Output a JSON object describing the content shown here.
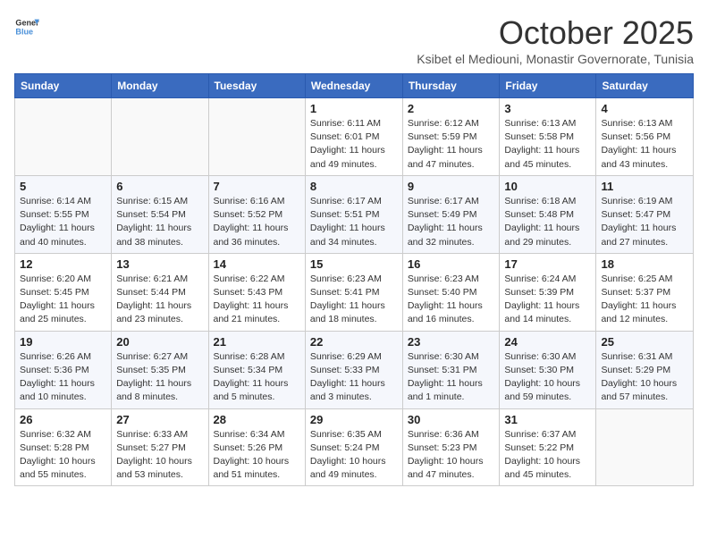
{
  "logo": {
    "line1": "General",
    "line2": "Blue"
  },
  "title": "October 2025",
  "subtitle": "Ksibet el Mediouni, Monastir Governorate, Tunisia",
  "weekdays": [
    "Sunday",
    "Monday",
    "Tuesday",
    "Wednesday",
    "Thursday",
    "Friday",
    "Saturday"
  ],
  "weeks": [
    [
      {
        "day": "",
        "info": ""
      },
      {
        "day": "",
        "info": ""
      },
      {
        "day": "",
        "info": ""
      },
      {
        "day": "1",
        "info": "Sunrise: 6:11 AM\nSunset: 6:01 PM\nDaylight: 11 hours\nand 49 minutes."
      },
      {
        "day": "2",
        "info": "Sunrise: 6:12 AM\nSunset: 5:59 PM\nDaylight: 11 hours\nand 47 minutes."
      },
      {
        "day": "3",
        "info": "Sunrise: 6:13 AM\nSunset: 5:58 PM\nDaylight: 11 hours\nand 45 minutes."
      },
      {
        "day": "4",
        "info": "Sunrise: 6:13 AM\nSunset: 5:56 PM\nDaylight: 11 hours\nand 43 minutes."
      }
    ],
    [
      {
        "day": "5",
        "info": "Sunrise: 6:14 AM\nSunset: 5:55 PM\nDaylight: 11 hours\nand 40 minutes."
      },
      {
        "day": "6",
        "info": "Sunrise: 6:15 AM\nSunset: 5:54 PM\nDaylight: 11 hours\nand 38 minutes."
      },
      {
        "day": "7",
        "info": "Sunrise: 6:16 AM\nSunset: 5:52 PM\nDaylight: 11 hours\nand 36 minutes."
      },
      {
        "day": "8",
        "info": "Sunrise: 6:17 AM\nSunset: 5:51 PM\nDaylight: 11 hours\nand 34 minutes."
      },
      {
        "day": "9",
        "info": "Sunrise: 6:17 AM\nSunset: 5:49 PM\nDaylight: 11 hours\nand 32 minutes."
      },
      {
        "day": "10",
        "info": "Sunrise: 6:18 AM\nSunset: 5:48 PM\nDaylight: 11 hours\nand 29 minutes."
      },
      {
        "day": "11",
        "info": "Sunrise: 6:19 AM\nSunset: 5:47 PM\nDaylight: 11 hours\nand 27 minutes."
      }
    ],
    [
      {
        "day": "12",
        "info": "Sunrise: 6:20 AM\nSunset: 5:45 PM\nDaylight: 11 hours\nand 25 minutes."
      },
      {
        "day": "13",
        "info": "Sunrise: 6:21 AM\nSunset: 5:44 PM\nDaylight: 11 hours\nand 23 minutes."
      },
      {
        "day": "14",
        "info": "Sunrise: 6:22 AM\nSunset: 5:43 PM\nDaylight: 11 hours\nand 21 minutes."
      },
      {
        "day": "15",
        "info": "Sunrise: 6:23 AM\nSunset: 5:41 PM\nDaylight: 11 hours\nand 18 minutes."
      },
      {
        "day": "16",
        "info": "Sunrise: 6:23 AM\nSunset: 5:40 PM\nDaylight: 11 hours\nand 16 minutes."
      },
      {
        "day": "17",
        "info": "Sunrise: 6:24 AM\nSunset: 5:39 PM\nDaylight: 11 hours\nand 14 minutes."
      },
      {
        "day": "18",
        "info": "Sunrise: 6:25 AM\nSunset: 5:37 PM\nDaylight: 11 hours\nand 12 minutes."
      }
    ],
    [
      {
        "day": "19",
        "info": "Sunrise: 6:26 AM\nSunset: 5:36 PM\nDaylight: 11 hours\nand 10 minutes."
      },
      {
        "day": "20",
        "info": "Sunrise: 6:27 AM\nSunset: 5:35 PM\nDaylight: 11 hours\nand 8 minutes."
      },
      {
        "day": "21",
        "info": "Sunrise: 6:28 AM\nSunset: 5:34 PM\nDaylight: 11 hours\nand 5 minutes."
      },
      {
        "day": "22",
        "info": "Sunrise: 6:29 AM\nSunset: 5:33 PM\nDaylight: 11 hours\nand 3 minutes."
      },
      {
        "day": "23",
        "info": "Sunrise: 6:30 AM\nSunset: 5:31 PM\nDaylight: 11 hours\nand 1 minute."
      },
      {
        "day": "24",
        "info": "Sunrise: 6:30 AM\nSunset: 5:30 PM\nDaylight: 10 hours\nand 59 minutes."
      },
      {
        "day": "25",
        "info": "Sunrise: 6:31 AM\nSunset: 5:29 PM\nDaylight: 10 hours\nand 57 minutes."
      }
    ],
    [
      {
        "day": "26",
        "info": "Sunrise: 6:32 AM\nSunset: 5:28 PM\nDaylight: 10 hours\nand 55 minutes."
      },
      {
        "day": "27",
        "info": "Sunrise: 6:33 AM\nSunset: 5:27 PM\nDaylight: 10 hours\nand 53 minutes."
      },
      {
        "day": "28",
        "info": "Sunrise: 6:34 AM\nSunset: 5:26 PM\nDaylight: 10 hours\nand 51 minutes."
      },
      {
        "day": "29",
        "info": "Sunrise: 6:35 AM\nSunset: 5:24 PM\nDaylight: 10 hours\nand 49 minutes."
      },
      {
        "day": "30",
        "info": "Sunrise: 6:36 AM\nSunset: 5:23 PM\nDaylight: 10 hours\nand 47 minutes."
      },
      {
        "day": "31",
        "info": "Sunrise: 6:37 AM\nSunset: 5:22 PM\nDaylight: 10 hours\nand 45 minutes."
      },
      {
        "day": "",
        "info": ""
      }
    ]
  ]
}
